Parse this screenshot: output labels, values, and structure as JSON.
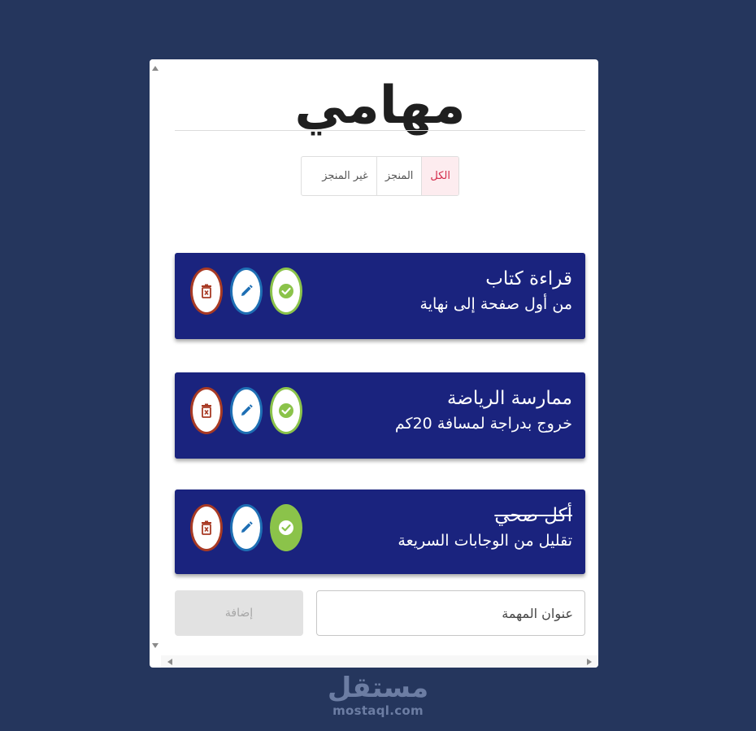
{
  "header": {
    "title": "مهامي"
  },
  "filters": [
    {
      "label": "الكل",
      "active": true
    },
    {
      "label": "المنجز",
      "active": false
    },
    {
      "label": "غير المنجز",
      "active": false
    }
  ],
  "tasks": [
    {
      "title": "قراءة كتاب",
      "description": "من أول صفحة إلى نهاية",
      "completed": false
    },
    {
      "title": "ممارسة الرياضة",
      "description": "خروج بدراجة لمسافة 20كم",
      "completed": false
    },
    {
      "title": "أكل صحي",
      "description": "تقليل من الوجابات السريعة",
      "completed": true
    }
  ],
  "form": {
    "add_label": "إضافة",
    "input_placeholder": "عنوان المهمة",
    "input_value": ""
  },
  "colors": {
    "background": "#25365d",
    "task_card": "#1a237e",
    "delete": "#a83a24",
    "edit": "#1e6fb4",
    "done": "#8bc34a",
    "active_filter": "#d42a4a"
  },
  "watermark": {
    "arabic": "مستقل",
    "latin": "mostaql.com"
  }
}
